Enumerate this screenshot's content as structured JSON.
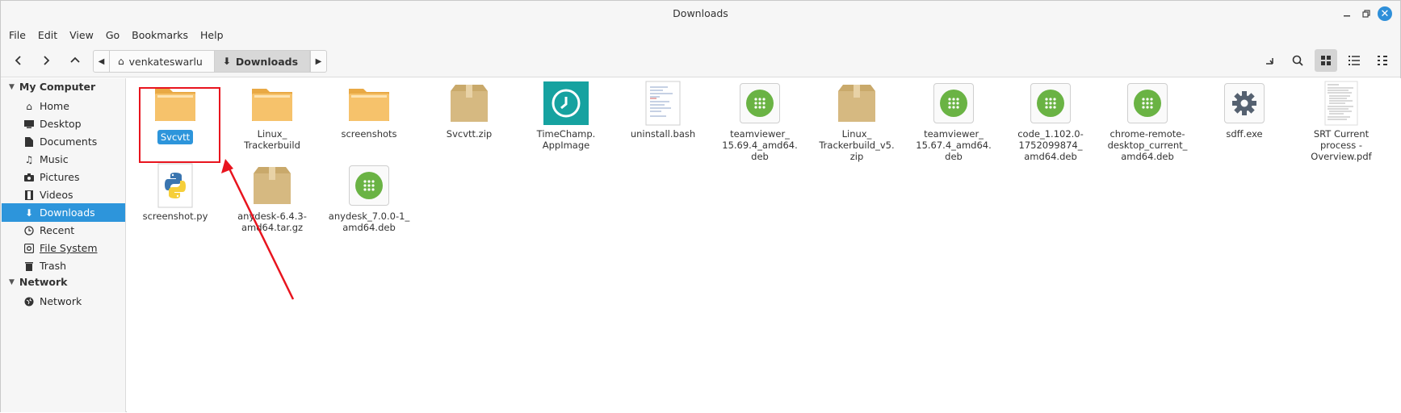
{
  "window": {
    "title": "Downloads"
  },
  "menu": [
    "File",
    "Edit",
    "View",
    "Go",
    "Bookmarks",
    "Help"
  ],
  "breadcrumb": {
    "parent": "venkateswarlu",
    "current": "Downloads"
  },
  "sidebar": {
    "sections": [
      {
        "label": "My Computer"
      },
      {
        "label": "Network"
      }
    ],
    "items": [
      {
        "label": "Home",
        "icon": "home-icon"
      },
      {
        "label": "Desktop",
        "icon": "desktop-icon"
      },
      {
        "label": "Documents",
        "icon": "document-icon"
      },
      {
        "label": "Music",
        "icon": "music-icon"
      },
      {
        "label": "Pictures",
        "icon": "camera-icon"
      },
      {
        "label": "Videos",
        "icon": "film-icon"
      },
      {
        "label": "Downloads",
        "icon": "download-icon",
        "selected": true
      },
      {
        "label": "Recent",
        "icon": "clock-icon"
      },
      {
        "label": "File System",
        "icon": "drive-icon"
      },
      {
        "label": "Trash",
        "icon": "trash-icon"
      }
    ],
    "network_items": [
      {
        "label": "Network",
        "icon": "globe-icon"
      }
    ]
  },
  "files": [
    {
      "label": "Svcvtt",
      "type": "folder",
      "selected": true
    },
    {
      "label": "Linux_\nTrackerbuild",
      "type": "folder"
    },
    {
      "label": "screenshots",
      "type": "folder"
    },
    {
      "label": "Svcvtt.zip",
      "type": "archive"
    },
    {
      "label": "TimeChamp.\nAppImage",
      "type": "appimage"
    },
    {
      "label": "uninstall.bash",
      "type": "text"
    },
    {
      "label": "teamviewer_\n15.69.4_amd64.\ndeb",
      "type": "deb"
    },
    {
      "label": "Linux_\nTrackerbuild_v5.\nzip",
      "type": "archive"
    },
    {
      "label": "teamviewer_\n15.67.4_amd64.\ndeb",
      "type": "deb"
    },
    {
      "label": "code_1.102.0-\n1752099874_\namd64.deb",
      "type": "deb"
    },
    {
      "label": "chrome-remote-\ndesktop_current_\namd64.deb",
      "type": "deb"
    },
    {
      "label": "sdff.exe",
      "type": "exe"
    },
    {
      "label": "SRT Current\nprocess -\nOverview.pdf",
      "type": "pdf"
    },
    {
      "label": "screenshot.py",
      "type": "python"
    },
    {
      "label": "anydesk-6.4.3-\namd64.tar.gz",
      "type": "archive"
    },
    {
      "label": "anydesk_7.0.0-1_\namd64.deb",
      "type": "deb"
    }
  ],
  "colors": {
    "accent": "#2d95db",
    "annotation": "#e8141e",
    "folder": "#f6c26b",
    "deb": "#6ab344",
    "timechamp": "#16a2a0"
  }
}
